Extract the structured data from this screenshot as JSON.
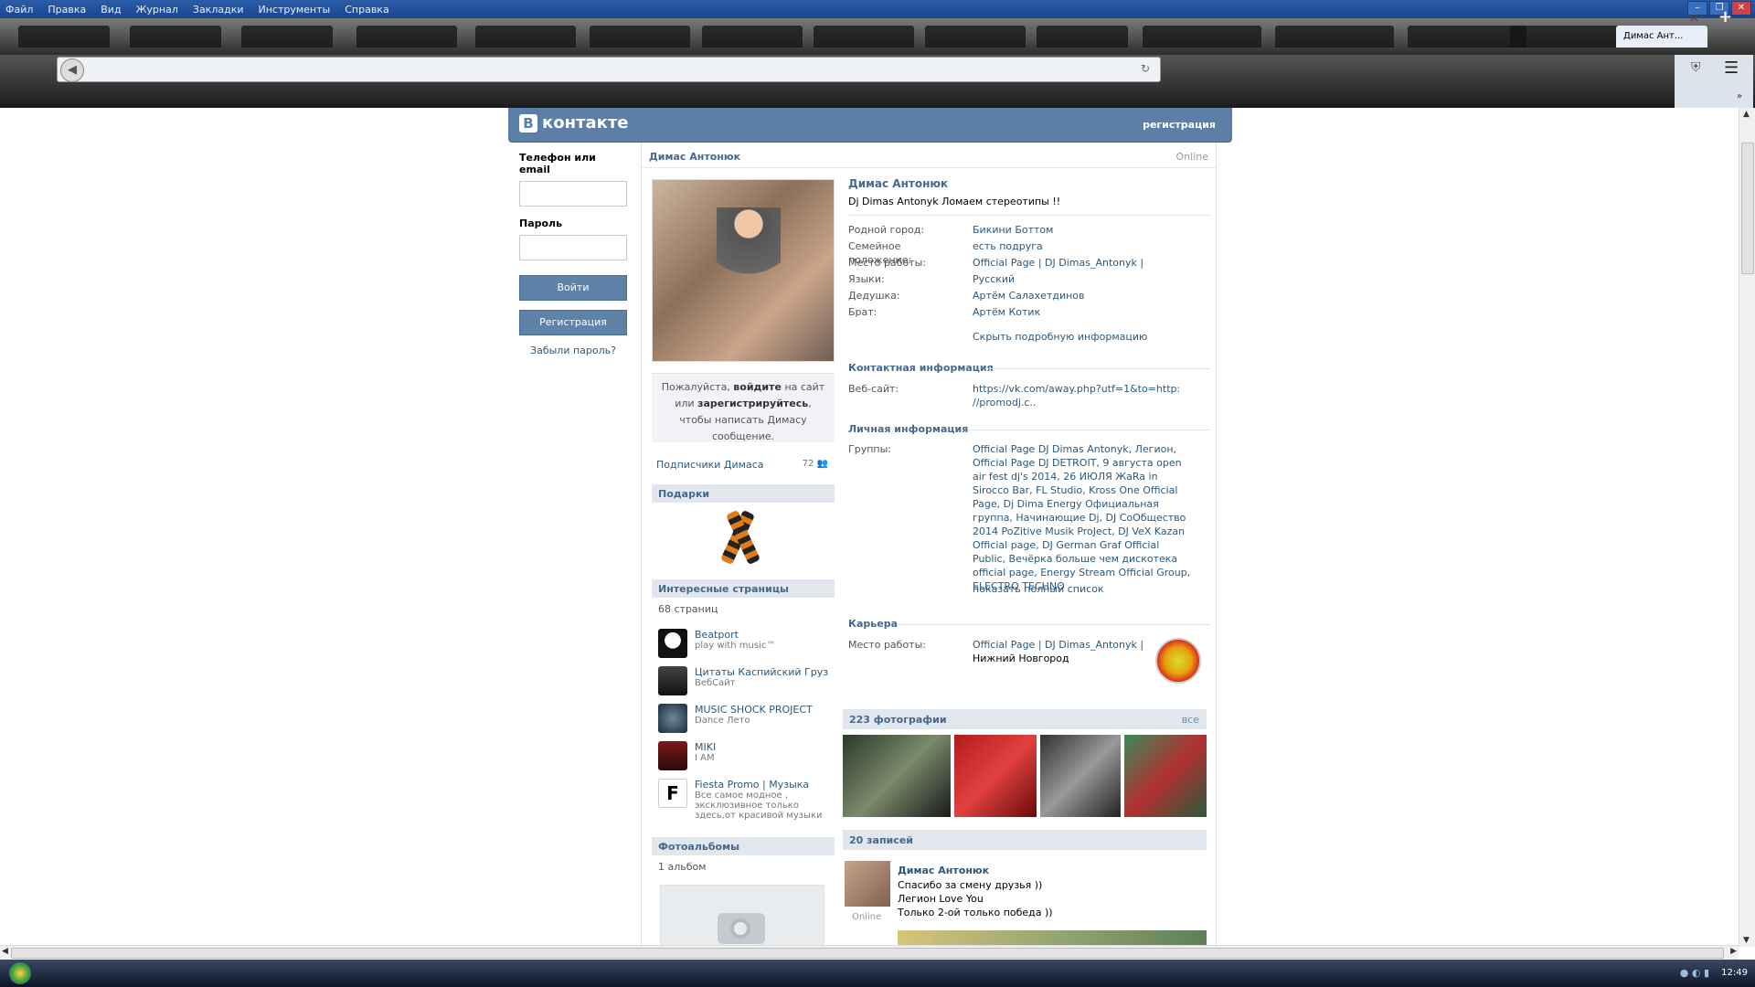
{
  "browser": {
    "menu": [
      "Файл",
      "Правка",
      "Вид",
      "Журнал",
      "Закладки",
      "Инструменты",
      "Справка"
    ],
    "active_tab": "Димас Ант...",
    "clock": "12:49"
  },
  "vk": {
    "logo": "контакте",
    "logo_letter": "В",
    "register_link": "регистрация",
    "login": {
      "phone_label": "Телефон или email",
      "password_label": "Пароль",
      "login_btn": "Войти",
      "register_btn": "Регистрация",
      "forgot": "Забыли пароль?"
    },
    "profile_header": {
      "name": "Димас Антонюк",
      "online": "Online"
    },
    "message_box": {
      "p1": "Пожалуйста, ",
      "b1": "войдите",
      "p2": " на сайт или ",
      "b2": "зарегистрируйтесь",
      "p3": ", чтобы написать Димасу сообщение."
    },
    "subscribers": {
      "label": "Подписчики Димаса",
      "count": "72"
    },
    "gifts_title": "Подарки",
    "interesting": {
      "title": "Интересные страницы",
      "count": "68 страниц",
      "items": [
        {
          "title": "Beatport",
          "sub": "play with music™"
        },
        {
          "title": "Цитаты Каспийский Груз",
          "sub": "ВебСайт"
        },
        {
          "title": "MUSIC SHOCK PROJECT",
          "sub": "Dance Лето"
        },
        {
          "title": "MIKI",
          "sub": "I AM"
        },
        {
          "title": "Fiesta Promo | Музыка",
          "sub": "Все самое модное , эксклюзивное только здесь,от красивой музыки"
        }
      ]
    },
    "albums": {
      "title": "Фотоальбомы",
      "count": "1 альбом"
    },
    "info": {
      "name": "Димас Антонюк",
      "status": "Dj Dimas Antonyk Ломаем стереотипы !!",
      "rows": [
        {
          "k": "Родной город:",
          "v": "Бикини Боттом"
        },
        {
          "k": "Семейное положение:",
          "v": "есть подруга"
        },
        {
          "k": "Место работы:",
          "v": "Official Page | DJ Dimas_Antonyk |"
        },
        {
          "k": "Языки:",
          "v": "Русский"
        },
        {
          "k": "Дедушка:",
          "v": "Артём Салахетдинов"
        },
        {
          "k": "Брат:",
          "v": "Артём Котик"
        }
      ],
      "hide_link": "Скрыть подробную информацию",
      "contact_title": "Контактная информация",
      "website_k": "Веб-сайт:",
      "website_v1": "https://vk.com/away.php?utf=1&to=http:",
      "website_v2": "//promodj.c..",
      "personal_title": "Личная информация",
      "groups_k": "Группы:",
      "groups_v": "Official Page DJ Dimas Antonyk, Легион, Official Page DJ DETROIT, 9 августа open air fest dj's 2014, 26 ИЮЛЯ ЖаRa in Sirocco Bar, FL Studio, Kross One Official Page, Dj Dima Energy Официальная группа, Начинающие Dj, DJ СоОбщество 2014 PoZitive Musik ProJect, DJ VeX Kazan Official page, DJ German Graf Official Public, Вечёрка больше чем дискотека official page, Energy Stream Official Group, ELECTRO TECHNO",
      "show_all": "показать полный список",
      "career_title": "Карьера",
      "career_k": "Место работы:",
      "career_v": "Official Page | DJ Dimas_Antonyk |",
      "career_city": "Нижний Новгород"
    },
    "photos": {
      "title": "223 фотографии",
      "all": "все"
    },
    "posts": {
      "title": "20 записей",
      "author": "Димас Антонюк",
      "online": "Online",
      "lines": [
        "Спасибо за смену друзья ))",
        "Легион Love You",
        "Только 2-ой только победа ))"
      ]
    }
  }
}
